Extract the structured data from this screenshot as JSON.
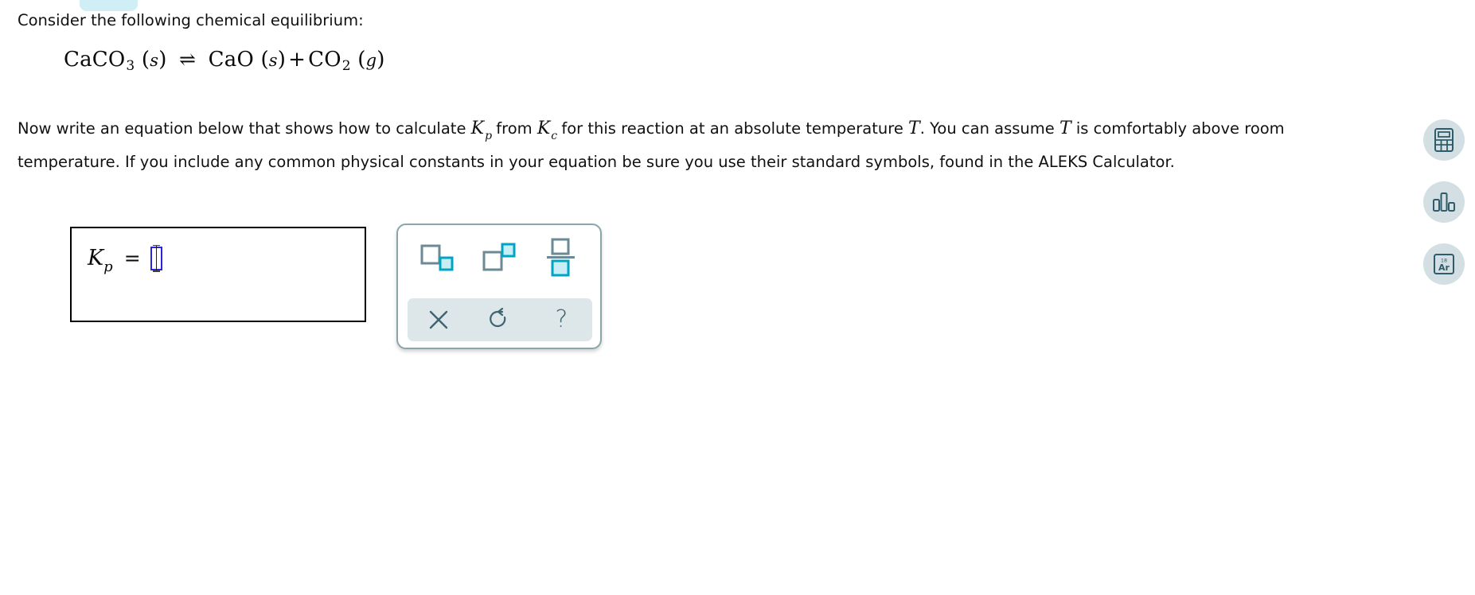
{
  "page": {
    "intro_text": "Consider the following chemical equilibrium:",
    "tab_color": "#cfeef5"
  },
  "equation": {
    "reactant": "CaCO",
    "reactant_sub": "3",
    "reactant_state": "s",
    "arrow": "⇌",
    "product1": "CaO",
    "product1_state": "s",
    "plus": "+",
    "product2": "CO",
    "product2_sub": "2",
    "product2_state": "g"
  },
  "body": {
    "part1": "Now write an equation below that shows how to calculate ",
    "kp_symbol": "K",
    "kp_sub": "p",
    "part2": " from ",
    "kc_symbol": "K",
    "kc_sub": "c",
    "part3": " for this reaction at an absolute temperature ",
    "t_symbol": "T",
    "part4": ". You can assume ",
    "t_symbol2": "T",
    "part5": " is comfortably above room temperature. If you include any common physical constants in your equation be sure you use their standard symbols, found in the ALEKS Calculator."
  },
  "answer": {
    "lhs_symbol": "K",
    "lhs_sub": "p",
    "equals": "=",
    "value": "",
    "placeholder": ""
  },
  "palette": {
    "border_color": "#8aa6ad",
    "accent_color": "#00a5c4",
    "accent_fill": "#c9edf5",
    "outline_color": "#6b8a94",
    "strip_color": "#dde6e8",
    "icon_color": "#3e6472",
    "buttons": [
      {
        "name": "subscript",
        "label": "□▂"
      },
      {
        "name": "superscript",
        "label": "□²"
      },
      {
        "name": "fraction",
        "label": "□/□"
      }
    ],
    "actions": [
      {
        "name": "clear",
        "label": "×"
      },
      {
        "name": "undo",
        "label": "↺"
      },
      {
        "name": "help",
        "label": "?"
      }
    ]
  },
  "rail": {
    "bg_color": "#d3dfe2",
    "icon_color": "#2f5c6b",
    "buttons": [
      {
        "name": "calculator",
        "label": "Calculator"
      },
      {
        "name": "bar-chart",
        "label": "Data"
      },
      {
        "name": "periodic-table",
        "label": "Ar",
        "number": "18"
      }
    ]
  }
}
